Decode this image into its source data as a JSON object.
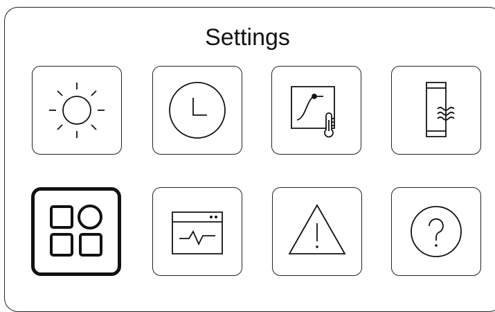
{
  "screen": {
    "title": "Settings"
  },
  "tiles": [
    {
      "icon": "sun-icon"
    },
    {
      "icon": "clock-icon"
    },
    {
      "icon": "heating-curve-thermometer-icon"
    },
    {
      "icon": "water-tank-icon"
    },
    {
      "icon": "apps-grid-icon",
      "selected": true
    },
    {
      "icon": "monitor-pulse-icon"
    },
    {
      "icon": "warning-triangle-icon"
    },
    {
      "icon": "help-question-icon"
    }
  ]
}
